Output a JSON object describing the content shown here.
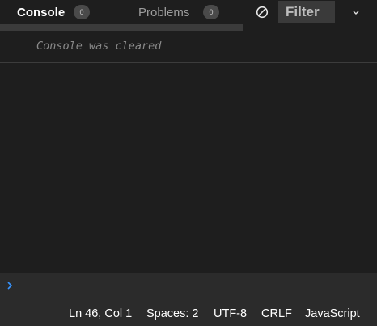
{
  "tabs": {
    "console": {
      "label": "Console",
      "count": "0"
    },
    "problems": {
      "label": "Problems",
      "count": "0"
    }
  },
  "toolbar": {
    "clear_icon": "circle-slash-icon",
    "filter_placeholder": "Filter",
    "expand_icon": "chevron-down-icon"
  },
  "console": {
    "message": "Console was cleared"
  },
  "input": {
    "prompt_icon": "chevron-right-icon"
  },
  "statusbar": {
    "position": "Ln 46, Col 1",
    "indentation": "Spaces: 2",
    "encoding": "UTF-8",
    "line_ending": "CRLF",
    "language": "JavaScript"
  },
  "colors": {
    "background": "#1e1e1e",
    "panel": "#2b2b2b",
    "prompt_accent": "#3794ff",
    "muted_text": "#8a8a8a"
  }
}
